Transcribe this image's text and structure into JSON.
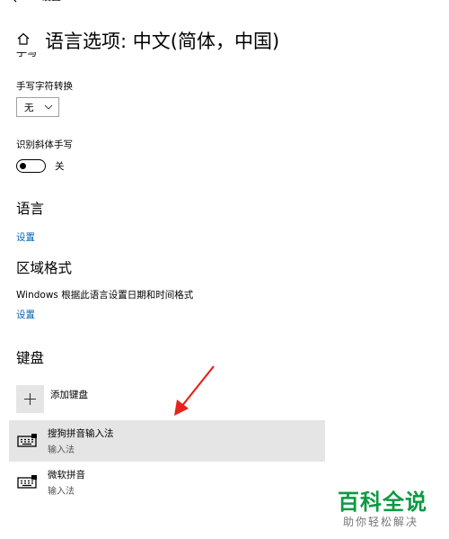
{
  "top": {
    "title": "设置"
  },
  "page": {
    "title": "语言选项: 中文(简体，中国)"
  },
  "handwriting": {
    "clipped_heading": "手写",
    "convert_label": "手写字符转换",
    "convert_value": "无",
    "italic_label": "识别斜体手写",
    "italic_toggle_state": "关"
  },
  "language": {
    "heading": "语言",
    "settings_link": "设置"
  },
  "region": {
    "heading": "区域格式",
    "description": "Windows 根据此语言设置日期和时间格式",
    "settings_link": "设置"
  },
  "keyboard": {
    "heading": "键盘",
    "add_label": "添加键盘",
    "items": [
      {
        "name": "搜狗拼音输入法",
        "type": "输入法",
        "selected": true
      },
      {
        "name": "微软拼音",
        "type": "输入法",
        "selected": false
      }
    ]
  },
  "watermark": {
    "title": "百科全说",
    "subtitle": "助你轻松解决"
  },
  "colors": {
    "link": "#0063b1",
    "selected_bg": "#e5e5e5",
    "arrow": "#e8221b",
    "watermark": "#0b9a42"
  },
  "icons": [
    "back-arrow-icon",
    "home-icon",
    "chevron-down-icon",
    "plus-icon",
    "keyboard-icon",
    "red-arrow-annotation"
  ]
}
